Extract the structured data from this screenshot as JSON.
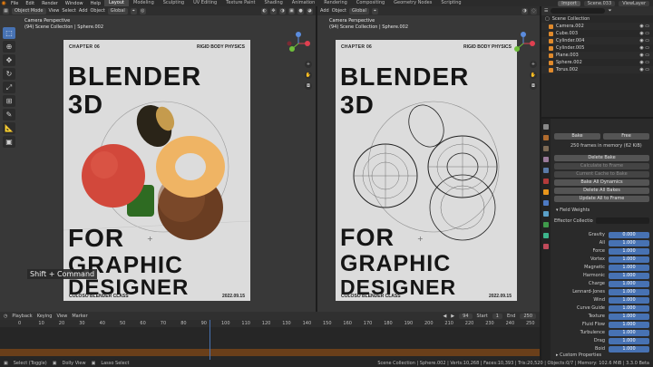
{
  "topbar": {
    "menu": [
      "File",
      "Edit",
      "Render",
      "Window",
      "Help"
    ],
    "workspaces": [
      "Layout",
      "Modeling",
      "Sculpting",
      "UV Editing",
      "Texture Paint",
      "Shading",
      "Animation",
      "Rendering",
      "Compositing",
      "Geometry Nodes",
      "Scripting"
    ],
    "active_workspace": "Layout",
    "import": "Import",
    "scene": "Scene.033",
    "view_layer": "ViewLayer"
  },
  "left_header": {
    "mode": "Object Mode",
    "menus": [
      "View",
      "Select",
      "Add",
      "Object"
    ],
    "orientation": "Global"
  },
  "right_header": {
    "menus": [
      "Add",
      "Object"
    ],
    "orientation": "Global"
  },
  "left_viewport": {
    "label": "Camera Perspective",
    "sub_label": "(94) Scene Collection | Sphere.002"
  },
  "right_viewport": {
    "label": "Camera Perspective",
    "sub_label": "(94) Scene Collection | Sphere.002"
  },
  "poster": {
    "chapter": "CHAPTER 06",
    "topic": "RIGID BODY PHYSICS",
    "line1": "BLENDER",
    "line2": "3D",
    "line3": "FOR",
    "line4": "GRAPHIC",
    "line5": "DESIGNER",
    "footer_left": "COLOSO BLENDER CLASS",
    "footer_right": "2022.09.15"
  },
  "shortcut_tip": "Shift + Command",
  "outliner": {
    "root": "Scene Collection",
    "items": [
      "Camera.002",
      "Cube.003",
      "Cylinder.004",
      "Cylinder.005",
      "Plane.003",
      "Sphere.002",
      "Torus.002"
    ]
  },
  "properties": {
    "bake_tabs": [
      "Bake",
      "Free"
    ],
    "frames_in_memory": "250 frames in memory (62 KiB)",
    "buttons": [
      "Delete Bake",
      "Calculate to Frame",
      "Current Cache to Bake",
      "Bake All Dynamics",
      "Delete All Bakes",
      "Update All to Frame"
    ],
    "disabled_buttons": [
      "Calculate to Frame",
      "Current Cache to Bake"
    ],
    "field_weights_title": "Field Weights",
    "effector_collection_label": "Effector Collectio",
    "field_weights": [
      {
        "label": "Gravity",
        "value": "0.000"
      },
      {
        "label": "All",
        "value": "1.000"
      },
      {
        "label": "Force",
        "value": "1.000"
      },
      {
        "label": "Vortex",
        "value": "1.000"
      },
      {
        "label": "Magnetic",
        "value": "1.000"
      },
      {
        "label": "Harmonic",
        "value": "1.000"
      },
      {
        "label": "Charge",
        "value": "1.000"
      },
      {
        "label": "Lennard-Jones",
        "value": "1.000"
      },
      {
        "label": "Wind",
        "value": "1.000"
      },
      {
        "label": "Curve Guide",
        "value": "1.000"
      },
      {
        "label": "Texture",
        "value": "1.000"
      },
      {
        "label": "Fluid Flow",
        "value": "1.000"
      },
      {
        "label": "Turbulence",
        "value": "1.000"
      },
      {
        "label": "Drag",
        "value": "1.000"
      },
      {
        "label": "Boid",
        "value": "1.000"
      }
    ],
    "custom_properties": "Custom Properties"
  },
  "timeline": {
    "menus": [
      "Playback",
      "Keying",
      "View",
      "Marker"
    ],
    "current_frame": "94",
    "start_label": "Start",
    "start": "1",
    "end_label": "End",
    "end": "250",
    "ruler": [
      "0",
      "10",
      "20",
      "30",
      "40",
      "50",
      "60",
      "70",
      "80",
      "90",
      "100",
      "110",
      "120",
      "130",
      "140",
      "150",
      "160",
      "170",
      "180",
      "190",
      "200",
      "210",
      "220",
      "230",
      "240",
      "250"
    ],
    "current_frame_fraction": 0.376
  },
  "status": {
    "select": "Select (Toggle)",
    "dolly": "Dolly View",
    "lasso": "Lasso Select",
    "stats": "Scene Collection | Sphere.002 | Verts:10,268 | Faces:10,393 | Tris:20,520 | Objects:0/7 | Memory: 102.6 MiB | 3.3.0 Beta"
  },
  "colors": {
    "accent": "#4772b3",
    "orange": "#e87d0d",
    "poster_bg": "#dcdcdc"
  }
}
